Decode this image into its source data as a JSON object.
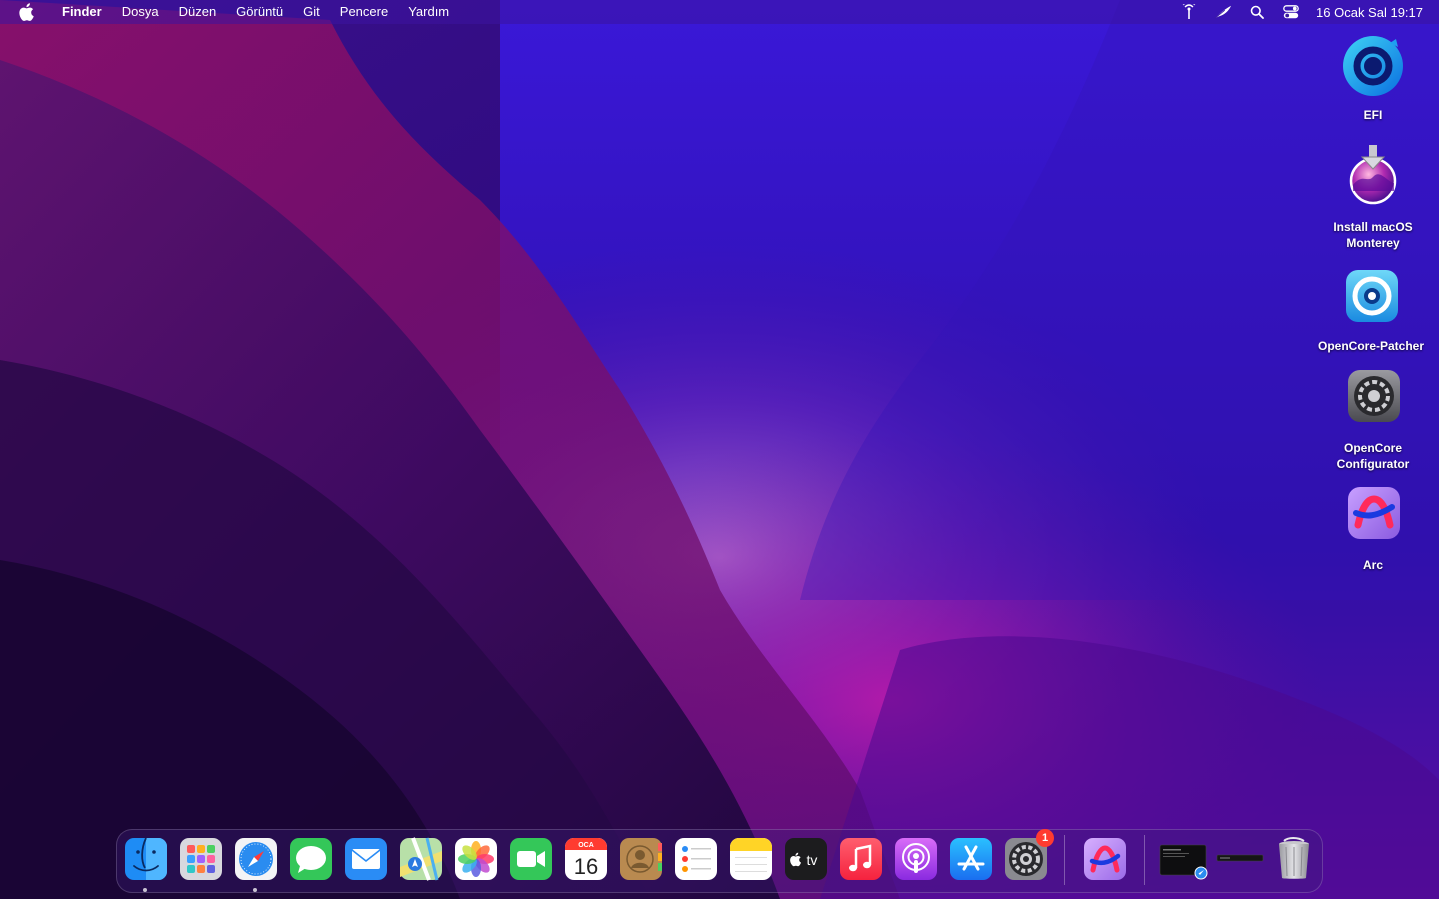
{
  "menubar": {
    "app_name": "Finder",
    "items": [
      "Dosya",
      "Düzen",
      "Görüntü",
      "Git",
      "Pencere",
      "Yardım"
    ],
    "clock": "16 Ocak Sal  19:17",
    "status_icons": [
      "antenna-icon",
      "feather-icon",
      "search-icon",
      "control-center-icon"
    ]
  },
  "desktop_icons": [
    {
      "label": "EFI",
      "icon": "efi-disk-icon"
    },
    {
      "label": "Install macOS Monterey",
      "icon": "install-monterey-icon"
    },
    {
      "label": "OpenCore-Patcher",
      "icon": "opencore-patcher-icon"
    },
    {
      "label": "OpenCore Configurator",
      "icon": "opencore-configurator-icon"
    },
    {
      "label": "Arc",
      "icon": "arc-icon"
    }
  ],
  "dock": {
    "calendar": {
      "month": "OCA",
      "day": "16"
    },
    "appletv_label": "tv",
    "settings_badge": "1",
    "colors": {
      "accent": "#0a84ff",
      "badge": "#ff3b30"
    }
  }
}
